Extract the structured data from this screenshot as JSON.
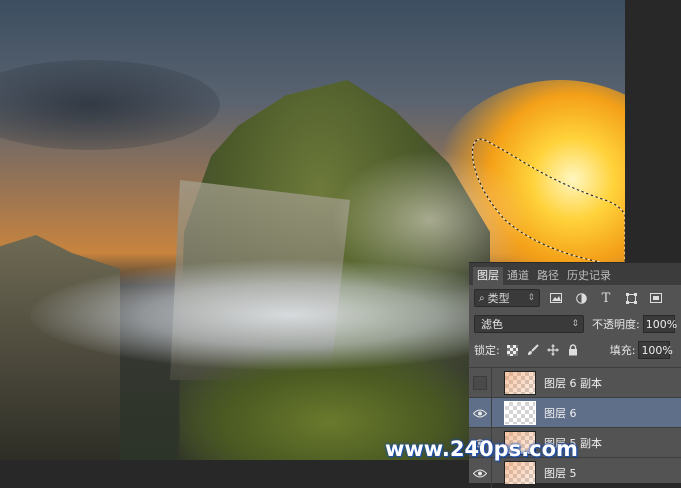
{
  "panel": {
    "tabs": [
      {
        "label": "图层",
        "active": true
      },
      {
        "label": "通道",
        "active": false
      },
      {
        "label": "路径",
        "active": false
      },
      {
        "label": "历史记录",
        "active": false
      }
    ],
    "filter": {
      "label": "类型"
    },
    "blend_mode": "滤色",
    "opacity_label": "不透明度:",
    "opacity_value": "100%",
    "lock_label": "锁定:",
    "fill_label": "填充:",
    "fill_value": "100%",
    "layers": [
      {
        "name": "图层 6 副本",
        "visible": false,
        "selected": false
      },
      {
        "name": "图层 6",
        "visible": true,
        "selected": true
      },
      {
        "name": "图层 5 副本",
        "visible": true,
        "selected": false
      },
      {
        "name": "图层 5",
        "visible": true,
        "selected": false
      }
    ]
  },
  "watermark": "www.240ps.com",
  "colors": {
    "selected_layer": "#5f6f8a",
    "panel_bg": "#535353"
  }
}
